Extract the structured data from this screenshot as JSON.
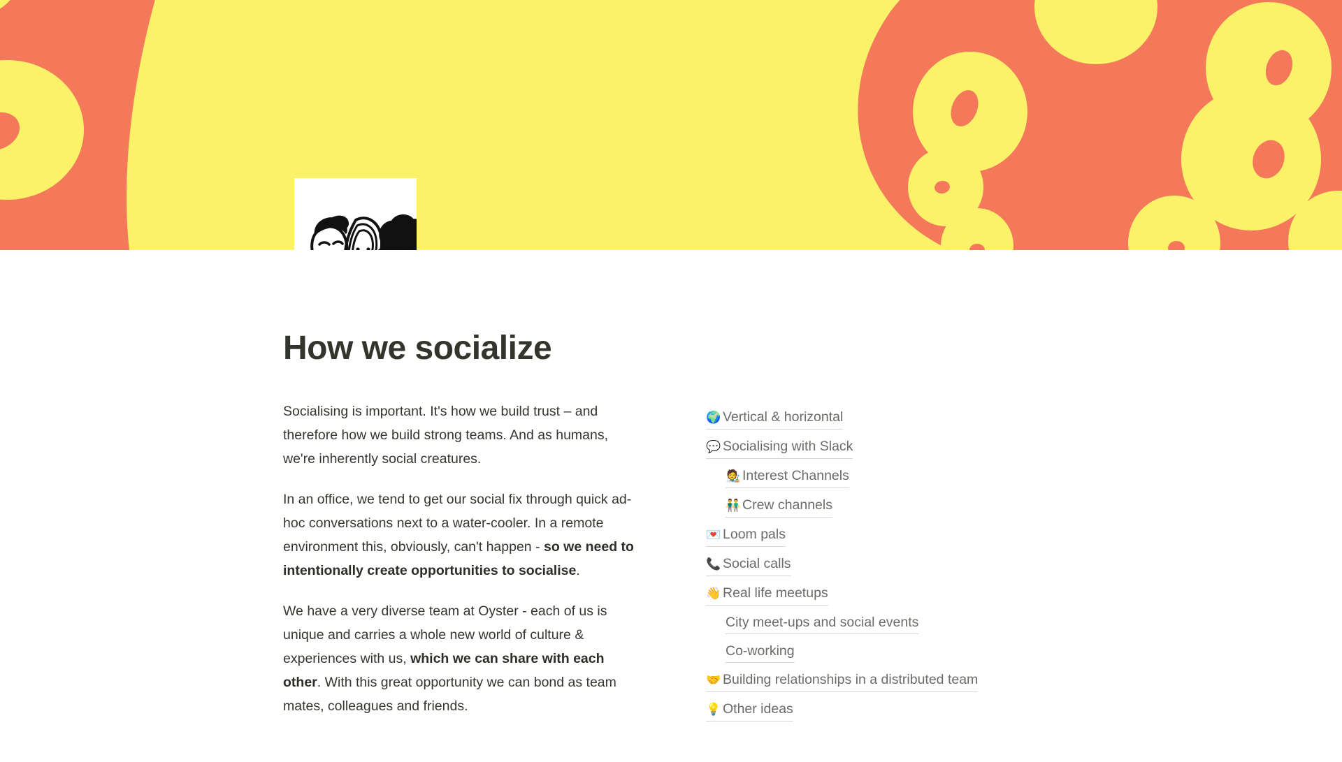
{
  "theme": {
    "banner_yellow": "#FCF26A",
    "banner_orange": "#F4795B",
    "title_color": "#32352B",
    "body_text_color": "#37352F",
    "link_color": "#6b6b68",
    "link_underline": "#d7d6d2",
    "page_background": "#FFFFFF"
  },
  "cover": {
    "icon_name": "three-doodle-faces-icon",
    "alt": "Hand-drawn doodle of three smiling faces"
  },
  "page_title": "How we socialize",
  "body": {
    "paragraphs": [
      {
        "id": "p1",
        "runs": [
          {
            "text": "Socialising is important. It's how we build trust – and therefore how we build strong teams. And as humans, we're inherently social creatures.",
            "bold": false
          }
        ]
      },
      {
        "id": "p2",
        "runs": [
          {
            "text": "In an office, we tend to get our social fix through quick ad-hoc conversations next to a water-cooler. In a remote environment this, obviously, can't happen -  ",
            "bold": false
          },
          {
            "text": "so we need to intentionally create opportunities to socialise",
            "bold": true
          },
          {
            "text": ".",
            "bold": false
          }
        ]
      },
      {
        "id": "p3",
        "runs": [
          {
            "text": "We have a very diverse team at Oyster - each of us is unique and carries a whole new world of culture & experiences with us, ",
            "bold": false
          },
          {
            "text": "which we can share with each other",
            "bold": true
          },
          {
            "text": ". With this great opportunity we can bond as team mates, colleagues and friends.",
            "bold": false
          }
        ]
      }
    ]
  },
  "table_of_contents": {
    "items": [
      {
        "emoji": "🌍",
        "icon_name": "globe-icon",
        "label": "Vertical & horizontal",
        "indent": 0
      },
      {
        "emoji": "💬",
        "icon_name": "speech-balloon-icon",
        "label": "Socialising with Slack",
        "indent": 0
      },
      {
        "emoji": "🧑‍🎨",
        "icon_name": "artist-icon",
        "label": "Interest Channels",
        "indent": 1
      },
      {
        "emoji": "👬",
        "icon_name": "two-men-holding-hands-icon",
        "label": "Crew channels",
        "indent": 1
      },
      {
        "emoji": "💌",
        "icon_name": "love-letter-icon",
        "label": "Loom pals",
        "indent": 0
      },
      {
        "emoji": "📞",
        "icon_name": "telephone-receiver-icon",
        "label": "Social calls",
        "indent": 0
      },
      {
        "emoji": "👋",
        "icon_name": "waving-hand-icon",
        "label": "Real life meetups",
        "indent": 0
      },
      {
        "emoji": "",
        "icon_name": "no-icon",
        "label": "City meet-ups and social events",
        "indent": 1
      },
      {
        "emoji": "",
        "icon_name": "no-icon",
        "label": "Co-working",
        "indent": 1
      },
      {
        "emoji": "🤝",
        "icon_name": "handshake-icon",
        "label": "Building relationships in a distributed team",
        "indent": 0
      },
      {
        "emoji": "💡",
        "icon_name": "light-bulb-icon",
        "label": "Other ideas",
        "indent": 0
      }
    ]
  }
}
